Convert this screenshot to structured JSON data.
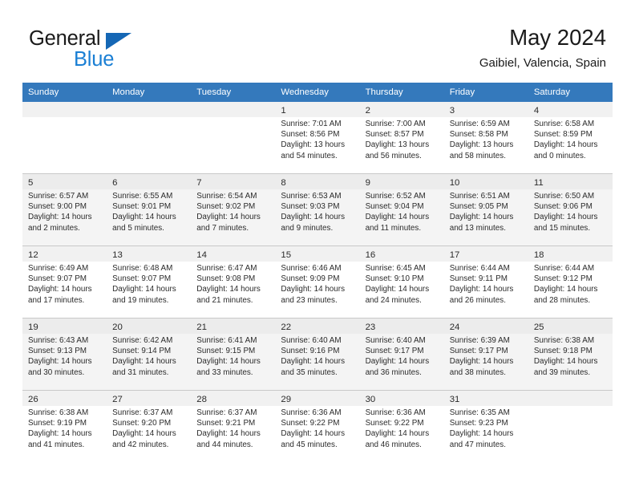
{
  "brand": {
    "word1": "General",
    "word2": "Blue",
    "triangle_color": "#1567b5",
    "blue_text_color": "#1a7fd4"
  },
  "header": {
    "title": "May 2024",
    "subtitle": "Gaibiel, Valencia, Spain"
  },
  "calendar": {
    "header_bg": "#3479bc",
    "header_text_color": "#ffffff",
    "weekday_headers": [
      "Sunday",
      "Monday",
      "Tuesday",
      "Wednesday",
      "Thursday",
      "Friday",
      "Saturday"
    ],
    "weeks": [
      [
        {
          "day": "",
          "sunrise": "",
          "sunset": "",
          "daylight_line1": "",
          "daylight_line2": ""
        },
        {
          "day": "",
          "sunrise": "",
          "sunset": "",
          "daylight_line1": "",
          "daylight_line2": ""
        },
        {
          "day": "",
          "sunrise": "",
          "sunset": "",
          "daylight_line1": "",
          "daylight_line2": ""
        },
        {
          "day": "1",
          "sunrise": "Sunrise: 7:01 AM",
          "sunset": "Sunset: 8:56 PM",
          "daylight_line1": "Daylight: 13 hours",
          "daylight_line2": "and 54 minutes."
        },
        {
          "day": "2",
          "sunrise": "Sunrise: 7:00 AM",
          "sunset": "Sunset: 8:57 PM",
          "daylight_line1": "Daylight: 13 hours",
          "daylight_line2": "and 56 minutes."
        },
        {
          "day": "3",
          "sunrise": "Sunrise: 6:59 AM",
          "sunset": "Sunset: 8:58 PM",
          "daylight_line1": "Daylight: 13 hours",
          "daylight_line2": "and 58 minutes."
        },
        {
          "day": "4",
          "sunrise": "Sunrise: 6:58 AM",
          "sunset": "Sunset: 8:59 PM",
          "daylight_line1": "Daylight: 14 hours",
          "daylight_line2": "and 0 minutes."
        }
      ],
      [
        {
          "day": "5",
          "sunrise": "Sunrise: 6:57 AM",
          "sunset": "Sunset: 9:00 PM",
          "daylight_line1": "Daylight: 14 hours",
          "daylight_line2": "and 2 minutes."
        },
        {
          "day": "6",
          "sunrise": "Sunrise: 6:55 AM",
          "sunset": "Sunset: 9:01 PM",
          "daylight_line1": "Daylight: 14 hours",
          "daylight_line2": "and 5 minutes."
        },
        {
          "day": "7",
          "sunrise": "Sunrise: 6:54 AM",
          "sunset": "Sunset: 9:02 PM",
          "daylight_line1": "Daylight: 14 hours",
          "daylight_line2": "and 7 minutes."
        },
        {
          "day": "8",
          "sunrise": "Sunrise: 6:53 AM",
          "sunset": "Sunset: 9:03 PM",
          "daylight_line1": "Daylight: 14 hours",
          "daylight_line2": "and 9 minutes."
        },
        {
          "day": "9",
          "sunrise": "Sunrise: 6:52 AM",
          "sunset": "Sunset: 9:04 PM",
          "daylight_line1": "Daylight: 14 hours",
          "daylight_line2": "and 11 minutes."
        },
        {
          "day": "10",
          "sunrise": "Sunrise: 6:51 AM",
          "sunset": "Sunset: 9:05 PM",
          "daylight_line1": "Daylight: 14 hours",
          "daylight_line2": "and 13 minutes."
        },
        {
          "day": "11",
          "sunrise": "Sunrise: 6:50 AM",
          "sunset": "Sunset: 9:06 PM",
          "daylight_line1": "Daylight: 14 hours",
          "daylight_line2": "and 15 minutes."
        }
      ],
      [
        {
          "day": "12",
          "sunrise": "Sunrise: 6:49 AM",
          "sunset": "Sunset: 9:07 PM",
          "daylight_line1": "Daylight: 14 hours",
          "daylight_line2": "and 17 minutes."
        },
        {
          "day": "13",
          "sunrise": "Sunrise: 6:48 AM",
          "sunset": "Sunset: 9:07 PM",
          "daylight_line1": "Daylight: 14 hours",
          "daylight_line2": "and 19 minutes."
        },
        {
          "day": "14",
          "sunrise": "Sunrise: 6:47 AM",
          "sunset": "Sunset: 9:08 PM",
          "daylight_line1": "Daylight: 14 hours",
          "daylight_line2": "and 21 minutes."
        },
        {
          "day": "15",
          "sunrise": "Sunrise: 6:46 AM",
          "sunset": "Sunset: 9:09 PM",
          "daylight_line1": "Daylight: 14 hours",
          "daylight_line2": "and 23 minutes."
        },
        {
          "day": "16",
          "sunrise": "Sunrise: 6:45 AM",
          "sunset": "Sunset: 9:10 PM",
          "daylight_line1": "Daylight: 14 hours",
          "daylight_line2": "and 24 minutes."
        },
        {
          "day": "17",
          "sunrise": "Sunrise: 6:44 AM",
          "sunset": "Sunset: 9:11 PM",
          "daylight_line1": "Daylight: 14 hours",
          "daylight_line2": "and 26 minutes."
        },
        {
          "day": "18",
          "sunrise": "Sunrise: 6:44 AM",
          "sunset": "Sunset: 9:12 PM",
          "daylight_line1": "Daylight: 14 hours",
          "daylight_line2": "and 28 minutes."
        }
      ],
      [
        {
          "day": "19",
          "sunrise": "Sunrise: 6:43 AM",
          "sunset": "Sunset: 9:13 PM",
          "daylight_line1": "Daylight: 14 hours",
          "daylight_line2": "and 30 minutes."
        },
        {
          "day": "20",
          "sunrise": "Sunrise: 6:42 AM",
          "sunset": "Sunset: 9:14 PM",
          "daylight_line1": "Daylight: 14 hours",
          "daylight_line2": "and 31 minutes."
        },
        {
          "day": "21",
          "sunrise": "Sunrise: 6:41 AM",
          "sunset": "Sunset: 9:15 PM",
          "daylight_line1": "Daylight: 14 hours",
          "daylight_line2": "and 33 minutes."
        },
        {
          "day": "22",
          "sunrise": "Sunrise: 6:40 AM",
          "sunset": "Sunset: 9:16 PM",
          "daylight_line1": "Daylight: 14 hours",
          "daylight_line2": "and 35 minutes."
        },
        {
          "day": "23",
          "sunrise": "Sunrise: 6:40 AM",
          "sunset": "Sunset: 9:17 PM",
          "daylight_line1": "Daylight: 14 hours",
          "daylight_line2": "and 36 minutes."
        },
        {
          "day": "24",
          "sunrise": "Sunrise: 6:39 AM",
          "sunset": "Sunset: 9:17 PM",
          "daylight_line1": "Daylight: 14 hours",
          "daylight_line2": "and 38 minutes."
        },
        {
          "day": "25",
          "sunrise": "Sunrise: 6:38 AM",
          "sunset": "Sunset: 9:18 PM",
          "daylight_line1": "Daylight: 14 hours",
          "daylight_line2": "and 39 minutes."
        }
      ],
      [
        {
          "day": "26",
          "sunrise": "Sunrise: 6:38 AM",
          "sunset": "Sunset: 9:19 PM",
          "daylight_line1": "Daylight: 14 hours",
          "daylight_line2": "and 41 minutes."
        },
        {
          "day": "27",
          "sunrise": "Sunrise: 6:37 AM",
          "sunset": "Sunset: 9:20 PM",
          "daylight_line1": "Daylight: 14 hours",
          "daylight_line2": "and 42 minutes."
        },
        {
          "day": "28",
          "sunrise": "Sunrise: 6:37 AM",
          "sunset": "Sunset: 9:21 PM",
          "daylight_line1": "Daylight: 14 hours",
          "daylight_line2": "and 44 minutes."
        },
        {
          "day": "29",
          "sunrise": "Sunrise: 6:36 AM",
          "sunset": "Sunset: 9:22 PM",
          "daylight_line1": "Daylight: 14 hours",
          "daylight_line2": "and 45 minutes."
        },
        {
          "day": "30",
          "sunrise": "Sunrise: 6:36 AM",
          "sunset": "Sunset: 9:22 PM",
          "daylight_line1": "Daylight: 14 hours",
          "daylight_line2": "and 46 minutes."
        },
        {
          "day": "31",
          "sunrise": "Sunrise: 6:35 AM",
          "sunset": "Sunset: 9:23 PM",
          "daylight_line1": "Daylight: 14 hours",
          "daylight_line2": "and 47 minutes."
        },
        {
          "day": "",
          "sunrise": "",
          "sunset": "",
          "daylight_line1": "",
          "daylight_line2": ""
        }
      ]
    ]
  }
}
